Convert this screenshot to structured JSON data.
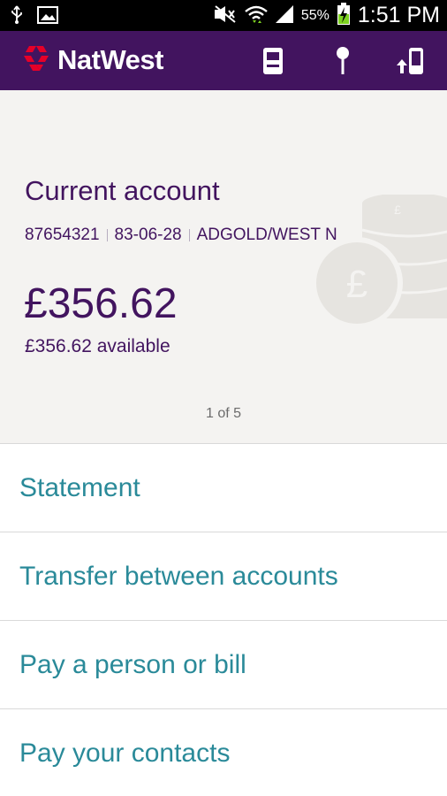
{
  "status_bar": {
    "battery_percent": "55%",
    "time": "1:51 PM",
    "icons": [
      "usb-icon",
      "image-icon",
      "mute-icon",
      "wifi-icon",
      "signal-icon",
      "battery-charging-icon"
    ]
  },
  "header": {
    "brand": "NatWest",
    "icons": [
      "atm-icon",
      "location-pin-icon",
      "mobile-topup-icon"
    ],
    "colors": {
      "background": "#42145f",
      "logo": "#e60028"
    }
  },
  "account": {
    "title": "Current account",
    "account_number": "87654321",
    "sort_code": "83-06-28",
    "account_name": "ADGOLD/WEST N",
    "balance": "£356.62",
    "available": "£356.62 available",
    "pager": "1 of 5"
  },
  "menu": {
    "items": [
      {
        "label": "Statement"
      },
      {
        "label": "Transfer between accounts"
      },
      {
        "label": "Pay a person or bill"
      },
      {
        "label": "Pay your contacts"
      }
    ],
    "color": "#2a8a99"
  }
}
